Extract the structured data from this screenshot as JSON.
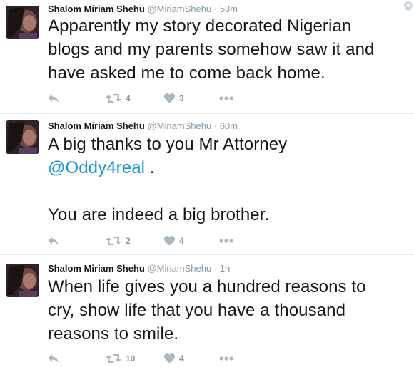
{
  "tweets": [
    {
      "fullname": "Shalom Miriam Shehu",
      "username": "@MiriamShehu",
      "separator": "·",
      "time": "53m",
      "text_lines": [
        "Apparently my story decorated Nigerian",
        "blogs and my parents somehow saw it and",
        "have asked me to come back home."
      ],
      "retweets": "4",
      "likes": "3"
    },
    {
      "fullname": "Shalom Miriam Shehu",
      "username": "@MiriamShehu",
      "separator": "·",
      "time": "60m",
      "text_line1": "A big thanks to you Mr Attorney",
      "mention": "@Oddy4real",
      "after_mention": " .",
      "text_line3": "You are indeed a big brother.",
      "retweets": "2",
      "likes": "4"
    },
    {
      "fullname": "Shalom Miriam Shehu",
      "username": "@MiriamShehu",
      "separator": "·",
      "time": "1h",
      "text_lines": [
        "When life gives you a hundred reasons to",
        "cry, show life that you have a thousand",
        "reasons to smile."
      ],
      "retweets": "10",
      "likes": "4"
    }
  ],
  "icons": {
    "reply": "reply-icon",
    "retweet": "retweet-icon",
    "like": "heart-icon",
    "more": "more-dots-icon",
    "geo": "location-pin-icon"
  },
  "colors": {
    "text": "#14171a",
    "muted": "#8899a6",
    "link": "#1b95e0",
    "icon": "#aab8c2",
    "divider": "#e6ecf0"
  }
}
